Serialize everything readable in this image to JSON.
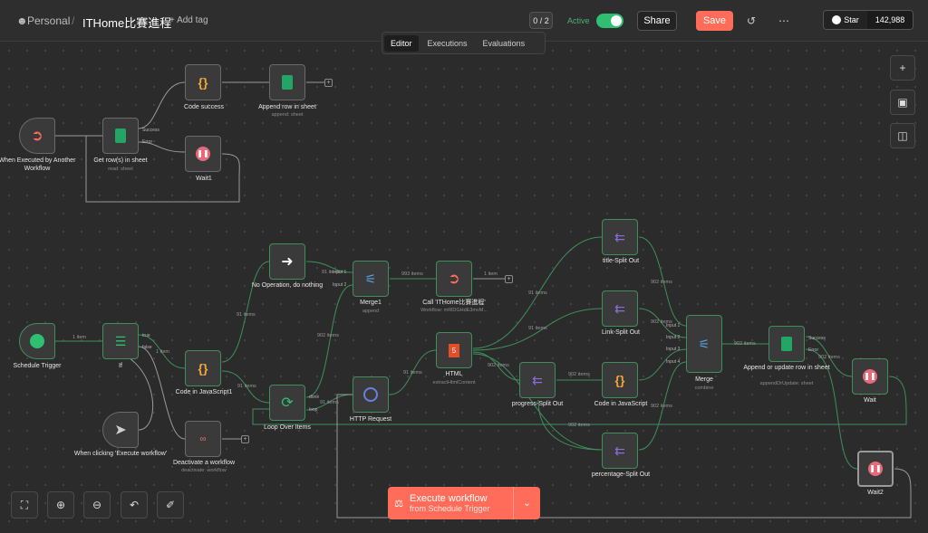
{
  "header": {
    "workspace": "Personal",
    "separator": "/",
    "workflow_title": "ITHome比賽進程",
    "add_tag": "+ Add tag",
    "counter": "0 / 2",
    "active_label": "Active",
    "share": "Share",
    "save": "Save",
    "github_star": "Star",
    "github_count": "142,988"
  },
  "tabs": [
    "Editor",
    "Executions",
    "Evaluations"
  ],
  "nodes": {
    "when_executed": "When Executed by Another Workflow",
    "get_rows": "Get row(s) in sheet",
    "get_rows_sub": "read: sheet",
    "code_success": "Code success",
    "append_row": "Append row in sheet",
    "append_row_sub": "append: sheet",
    "wait1": "Wait1",
    "schedule": "Schedule Trigger",
    "if": "If",
    "code_js1": "Code in JavaScript1",
    "noop": "No Operation, do nothing",
    "loop": "Loop Over Items",
    "http": "HTTP Request",
    "merge1": "Merge1",
    "merge1_sub": "append",
    "call": "Call 'ITHome比賽進程'",
    "call_sub": "Workflow: mRlDGHdE3mvM...",
    "html": "HTML",
    "html_sub": "extractHtmlContent",
    "title_split": "title-Split Out",
    "link_split": "Link-Split Out",
    "progress_split": "progress-Split Out",
    "code_js": "Code in JavaScript",
    "percentage_split": "percentage-Split Out",
    "merge": "Merge",
    "merge_sub": "combine",
    "append_update": "Append or update row in sheet",
    "append_update_sub": "appendOrUpdate: sheet",
    "wait": "Wait",
    "wait2": "Wait2",
    "manual": "When clicking 'Execute workflow'",
    "deactivate": "Deactivate a workflow",
    "deactivate_sub": "deactivate: workflow"
  },
  "ports": {
    "success": "Success",
    "error": "Error",
    "true": "true",
    "false": "false",
    "done": "done",
    "loop": "loop",
    "input1": "Input 1",
    "input2": "Input 2",
    "input3": "Input 3",
    "input4": "Input 4"
  },
  "edges": {
    "e1": "1 item",
    "e2": "1 item",
    "e3": "91 items",
    "e4": "91 items",
    "e5": "902 items",
    "e6": "91 items",
    "e7": "91 items",
    "e8": "993 items",
    "e9": "1 item",
    "e10": "91 items",
    "e11": "91 items",
    "e12": "91 items",
    "e13": "902 items",
    "e14": "902 items",
    "e15": "902 items",
    "e16": "902 items",
    "e17": "902 items",
    "e18": "902 items",
    "e19": "902 items",
    "e20": "902 items"
  },
  "execute_button": {
    "label": "Execute workflow",
    "sub": "from Schedule Trigger"
  },
  "colors": {
    "accent": "#ff6d5a",
    "success": "#4caf72",
    "sheets": "#22a565",
    "code": "#f2a53a",
    "split": "#8d6bd8",
    "wait": "#e66a7a",
    "http": "#6a7fe0"
  },
  "icons": [
    "user-icon",
    "history-icon",
    "more-icon",
    "github-icon",
    "plus-icon",
    "note-icon",
    "panel-icon",
    "fit-view-icon",
    "zoom-in-icon",
    "zoom-out-icon",
    "undo-icon",
    "clean-icon",
    "flask-icon",
    "chevron-down-icon"
  ]
}
